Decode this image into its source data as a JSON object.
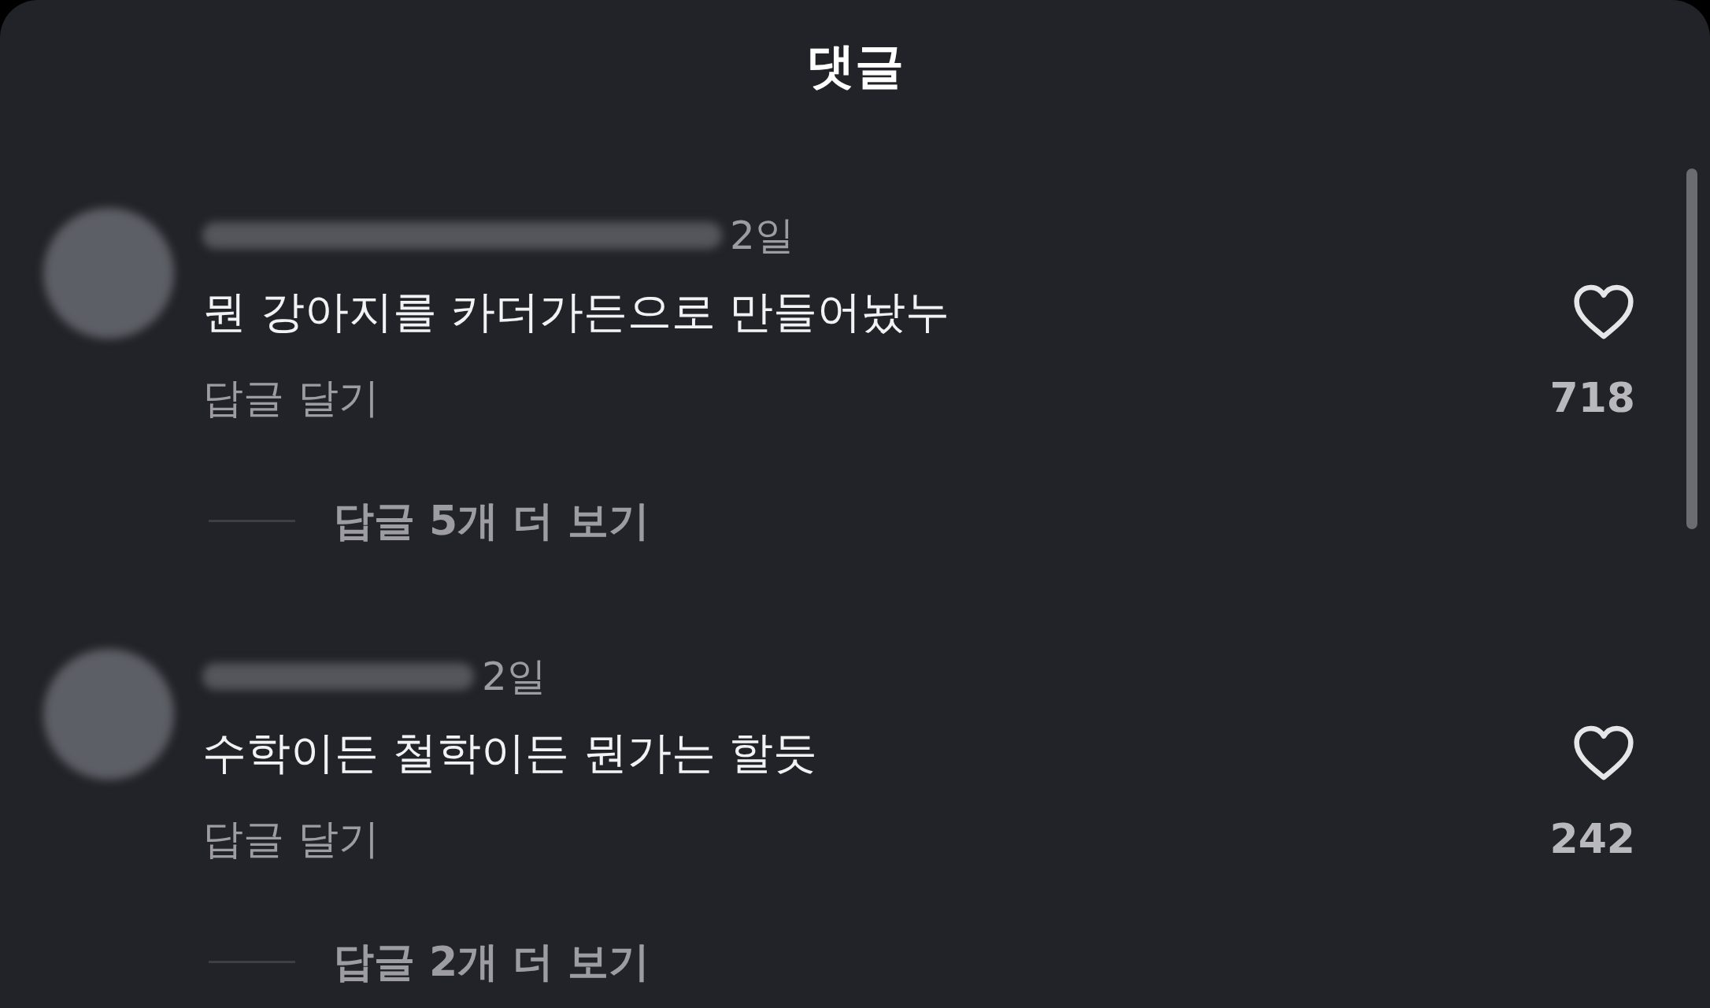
{
  "header": {
    "title": "댓글"
  },
  "comments": [
    {
      "time": "2일",
      "text": "뭔 강아지를 카더가든으로 만들어놨누",
      "reply_action": "답글 달기",
      "liked": false,
      "likes": "718",
      "more_replies": "답글 5개 더 보기"
    },
    {
      "time": "2일",
      "text": "수학이든 철학이든 뭔가는 할듯",
      "reply_action": "답글 달기",
      "liked": false,
      "likes": "242",
      "more_replies": "답글 2개 더 보기"
    }
  ]
}
